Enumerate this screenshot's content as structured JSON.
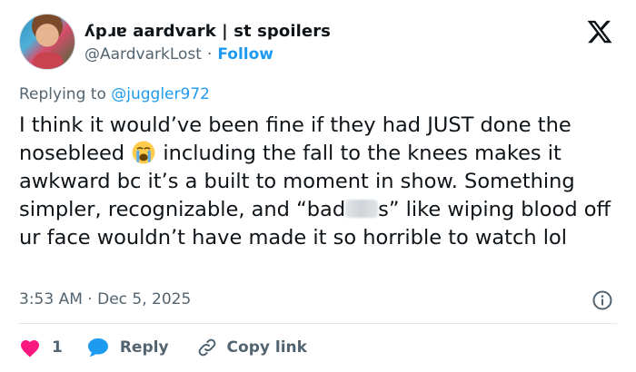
{
  "author": {
    "display_name": "ʎpɹɐ aardvark | st spoilers",
    "handle": "@AardvarkLost",
    "separator": "·",
    "follow_label": "Follow"
  },
  "reply_context": {
    "prefix": "Replying to",
    "mention": "@juggler972"
  },
  "tweet": {
    "text_part1": "I think it would’ve been fine if they had JUST done the nosebleed ",
    "emoji_name": "loudly-crying-face",
    "text_part2": " including the fall to the knees makes it awkward bc it’s a built to moment in show. Something simpler, recognizable, and “bad",
    "text_part3": "s” like wiping blood off ur face wouldn’t have made it so horrible to watch lol"
  },
  "meta": {
    "time": "3:53 AM",
    "separator": "·",
    "date": "Dec 5, 2025"
  },
  "actions": {
    "like_count": "1",
    "reply_label": "Reply",
    "copy_link_label": "Copy link"
  },
  "colors": {
    "accent": "#1d9bf0",
    "like": "#f91880",
    "secondary_text": "#536471",
    "primary_text": "#0f1419"
  },
  "icons": [
    "x-logo-icon",
    "info-icon",
    "heart-icon",
    "reply-bubble-icon",
    "link-icon"
  ]
}
